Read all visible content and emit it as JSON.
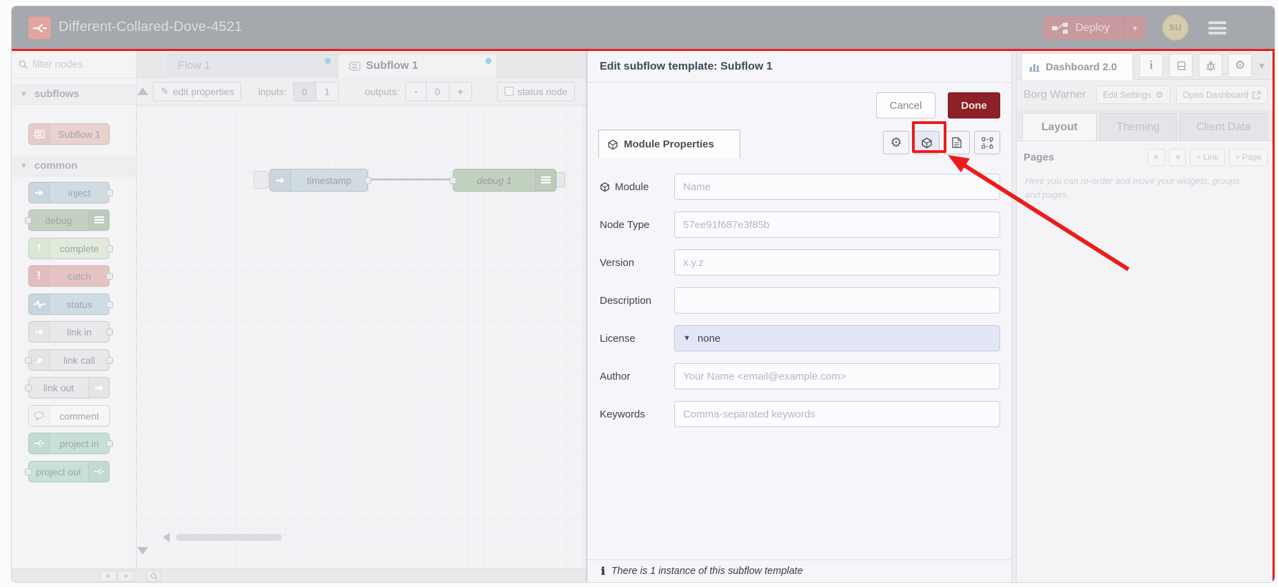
{
  "header": {
    "title": "Different-Collared-Dove-4521",
    "deploy_label": "Deploy",
    "avatar_initials": "su"
  },
  "palette": {
    "filter_placeholder": "filter nodes",
    "section_subflows": "subflows",
    "section_common": "common",
    "nodes": {
      "subflow1": "Subflow 1",
      "inject": "inject",
      "debug": "debug",
      "complete": "complete",
      "catch": "catch",
      "status": "status",
      "link_in": "link in",
      "link_call": "link call",
      "link_out": "link out",
      "comment": "comment",
      "project_in": "project in",
      "project_out": "project out"
    }
  },
  "workspace_tabs": {
    "flow1": "Flow 1",
    "subflow1": "Subflow 1"
  },
  "subflow_toolbar": {
    "edit_properties": "edit properties",
    "inputs_label": "inputs:",
    "input_options": [
      "0",
      "1"
    ],
    "outputs_label": "outputs:",
    "output_minus": "-",
    "output_value": "0",
    "output_plus": "+",
    "status_node": "status node"
  },
  "canvas": {
    "node_timestamp": "timestamp",
    "node_debug": "debug 1"
  },
  "dialog": {
    "title": "Edit subflow template: Subflow 1",
    "cancel_label": "Cancel",
    "done_label": "Done",
    "tab_label": "Module Properties",
    "fields": [
      {
        "label": "Module",
        "placeholder": "Name"
      },
      {
        "label": "Node Type",
        "placeholder": "57ee91f687e3f85b"
      },
      {
        "label": "Version",
        "placeholder": "x.y.z"
      },
      {
        "label": "Description",
        "placeholder": ""
      },
      {
        "label": "License",
        "value": "none"
      },
      {
        "label": "Author",
        "placeholder": "Your Name <email@example.com>"
      },
      {
        "label": "Keywords",
        "placeholder": "Comma-separated keywords"
      }
    ],
    "footer_text": "There is 1 instance of this subflow template"
  },
  "sidebar": {
    "tab_label": "Dashboard 2.0",
    "project_name": "Borg Warner",
    "edit_settings_label": "Edit Settings",
    "open_dashboard_label": "Open Dashboard",
    "tabs": [
      "Layout",
      "Theming",
      "Client Data"
    ],
    "pages_label": "Pages",
    "add_link_label": "+ Link",
    "add_page_label": "+ Page",
    "help_text": "Here you can re-order and move your widgets, groups and pages."
  },
  "colors": {
    "annotation_red": "#ee1b1b",
    "header_bg": "#5b6269",
    "deploy_red": "#9c484d",
    "done_red": "#8c2127",
    "unsaved_dot_blue": "#5da8cc",
    "license_select_bg": "#e3e6f6"
  }
}
